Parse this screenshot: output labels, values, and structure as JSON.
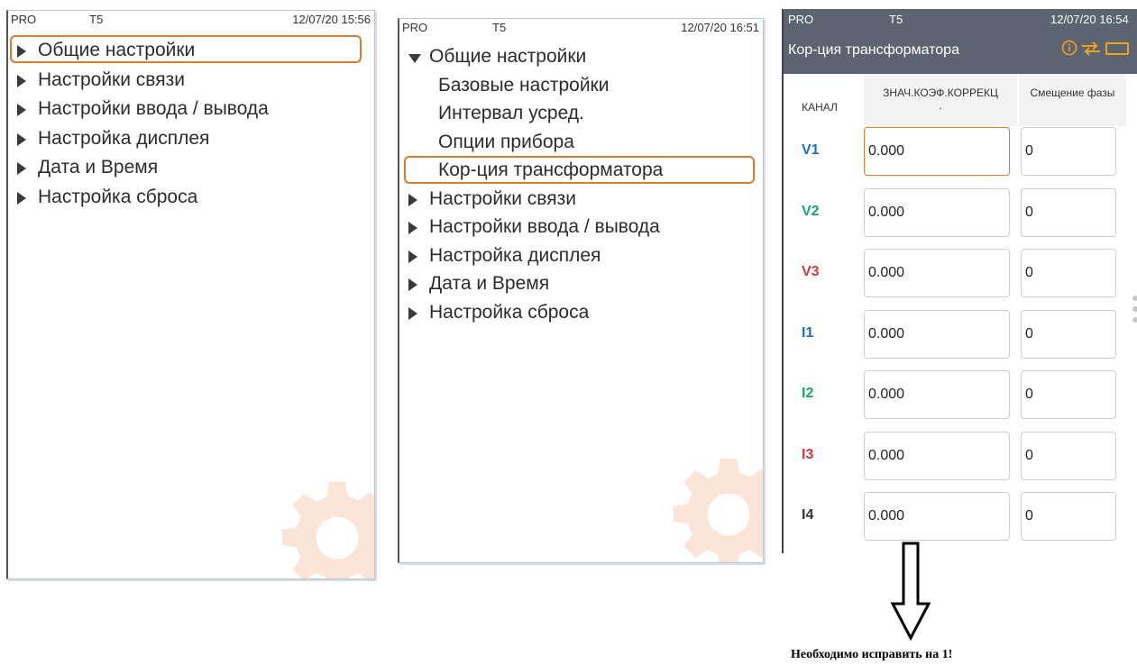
{
  "panel1": {
    "status": {
      "left": "PRO",
      "mid": "T5",
      "datetime": "12/07/20 15:56"
    },
    "items": [
      {
        "label": "Общие настройки",
        "expanded": false
      },
      {
        "label": "Настройки связи",
        "expanded": false
      },
      {
        "label": "Настройки ввода / вывода",
        "expanded": false
      },
      {
        "label": "Настройка дисплея",
        "expanded": false
      },
      {
        "label": "Дата и Время",
        "expanded": false
      },
      {
        "label": "Настройка сброса",
        "expanded": false
      }
    ],
    "selected_index": 0
  },
  "panel2": {
    "status": {
      "left": "PRO",
      "mid": "T5",
      "datetime": "12/07/20 16:51"
    },
    "items": [
      {
        "label": "Общие настройки",
        "expanded": true
      },
      {
        "label": "Базовые настройки",
        "sub": true
      },
      {
        "label": "Интервал усред.",
        "sub": true
      },
      {
        "label": "Опции прибора",
        "sub": true
      },
      {
        "label": "Кор-ция трансформатора",
        "sub": true
      },
      {
        "label": "Настройки связи",
        "expanded": false
      },
      {
        "label": "Настройки ввода / вывода",
        "expanded": false
      },
      {
        "label": "Настройка дисплея",
        "expanded": false
      },
      {
        "label": "Дата и Время",
        "expanded": false
      },
      {
        "label": "Настройка сброса",
        "expanded": false
      }
    ],
    "selected_index": 4
  },
  "panel3": {
    "status": {
      "left": "PRO",
      "mid": "T5",
      "datetime": "12/07/20 16:54"
    },
    "title": "Кор-ция трансформатора",
    "icons": [
      "info-icon",
      "transfer-arrows-icon",
      "battery-icon"
    ],
    "columns": {
      "channel": "КАНАЛ",
      "coef": "ЗНАЧ.КОЭФ.КОРРЕКЦ",
      "coef_tail": ".",
      "phase": "Смещение фазы"
    },
    "rows": [
      {
        "channel": "V1",
        "color": "#1a6fc4",
        "coef": "0.000",
        "phase": "0",
        "active": true
      },
      {
        "channel": "V2",
        "color": "#19a56b",
        "coef": "0.000",
        "phase": "0"
      },
      {
        "channel": "V3",
        "color": "#cc3b3b",
        "coef": "0.000",
        "phase": "0"
      },
      {
        "channel": "I1",
        "color": "#1a6fc4",
        "coef": "0.000",
        "phase": "0"
      },
      {
        "channel": "I2",
        "color": "#19a56b",
        "coef": "0.000",
        "phase": "0"
      },
      {
        "channel": "I3",
        "color": "#cc3b3b",
        "coef": "0.000",
        "phase": "0"
      },
      {
        "channel": "I4",
        "color": "#333333",
        "coef": "0.000",
        "phase": "0"
      }
    ]
  },
  "note": "Необходимо исправить на 1!",
  "colors": {
    "accent": "#e07a33",
    "header_bg": "#5b6470",
    "icon": "#f5a21b"
  }
}
